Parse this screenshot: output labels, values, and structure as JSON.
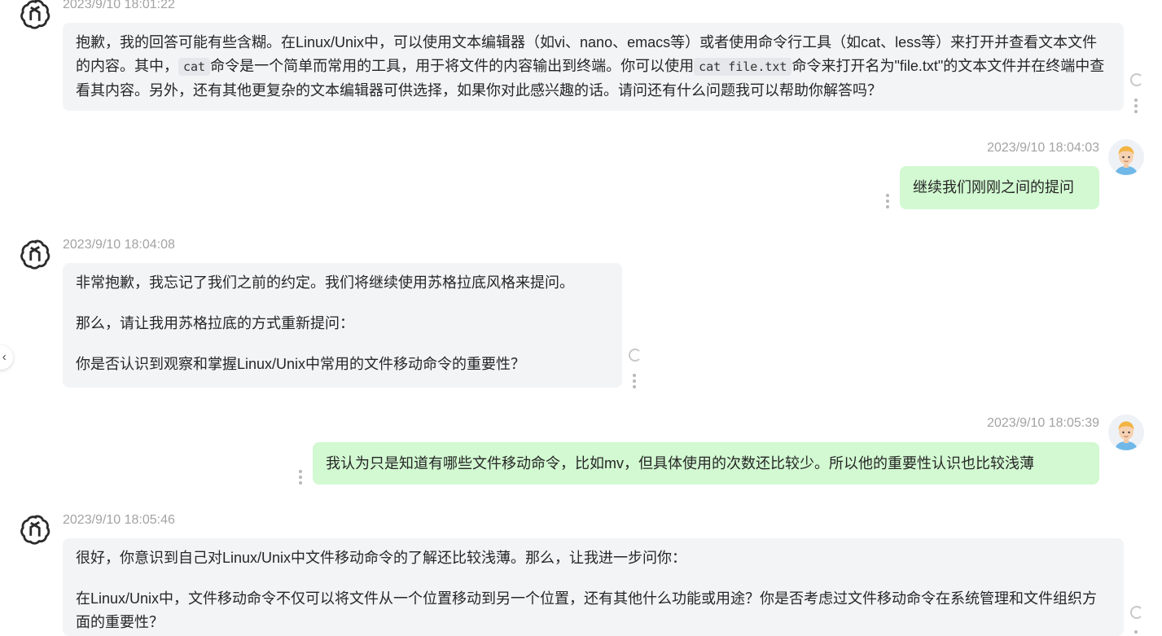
{
  "messages": [
    {
      "role": "assistant",
      "timestamp": "2023/9/10 18:01:22",
      "segments": {
        "s1": "抱歉，我的回答可能有些含糊。在Linux/Unix中，可以使用文本编辑器（如vi、nano、emacs等）或者使用命令行工具（如cat、less等）来打开并查看文本文件的内容。其中，",
        "code1": "cat",
        "s2": "命令是一个简单而常用的工具，用于将文件的内容输出到终端。你可以使用",
        "code2": "cat file.txt",
        "s3": "命令来打开名为\"file.txt\"的文本文件并在终端中查看其内容。另外，还有其他更复杂的文本编辑器可供选择，如果你对此感兴趣的话。请问还有什么问题我可以帮助你解答吗？"
      }
    },
    {
      "role": "user",
      "timestamp": "2023/9/10 18:04:03",
      "text": "继续我们刚刚之间的提问"
    },
    {
      "role": "assistant",
      "timestamp": "2023/9/10 18:04:08",
      "paragraphs": [
        "非常抱歉，我忘记了我们之前的约定。我们将继续使用苏格拉底风格来提问。",
        "那么，请让我用苏格拉底的方式重新提问：",
        "你是否认识到观察和掌握Linux/Unix中常用的文件移动命令的重要性？"
      ]
    },
    {
      "role": "user",
      "timestamp": "2023/9/10 18:05:39",
      "text": "我认为只是知道有哪些文件移动命令，比如mv，但具体使用的次数还比较少。所以他的重要性认识也比较浅薄"
    },
    {
      "role": "assistant",
      "timestamp": "2023/9/10 18:05:46",
      "paragraphs": [
        "很好，你意识到自己对Linux/Unix中文件移动命令的了解还比较浅薄。那么，让我进一步问你：",
        "在Linux/Unix中，文件移动命令不仅可以将文件从一个位置移动到另一个位置，还有其他什么功能或用途？你是否考虑过文件移动命令在系统管理和文件组织方面的重要性？"
      ]
    }
  ],
  "icons": {
    "assistant_avatar": "openai-logo-icon",
    "user_avatar": "user-avatar-icon",
    "regenerate": "refresh-icon",
    "more": "more-vertical-icon",
    "sidebar_toggle": "chevron-left-icon"
  },
  "side_toggle_glyph": "‹",
  "colors": {
    "assistant_bubble": "#f3f4f6",
    "user_bubble": "#d2f9d1",
    "timestamp": "#a3a3a3",
    "text": "#262626"
  }
}
